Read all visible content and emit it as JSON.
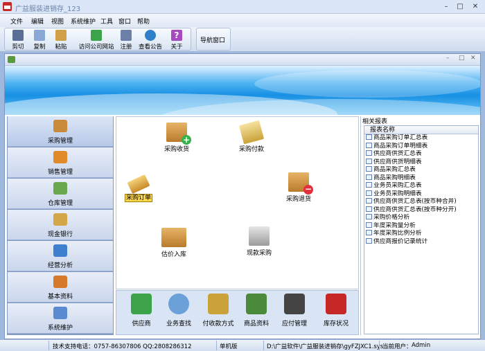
{
  "window": {
    "title": "广益服装进销存_123"
  },
  "menu": [
    "文件",
    "编辑",
    "视图",
    "系统维护",
    "工具",
    "窗口",
    "帮助"
  ],
  "toolbar": {
    "buttons": [
      {
        "label": "剪切",
        "icon": "scissors-icon"
      },
      {
        "label": "复制",
        "icon": "copy-icon"
      },
      {
        "label": "粘贴",
        "icon": "paste-icon"
      },
      {
        "label": "访问公司网站",
        "icon": "website-icon"
      },
      {
        "label": "注册",
        "icon": "register-icon"
      },
      {
        "label": "查看公告",
        "icon": "globe-icon"
      },
      {
        "label": "关于",
        "icon": "help-icon"
      }
    ],
    "nav_label": "导航窗口"
  },
  "sidebar": {
    "items": [
      {
        "label": "采购管理",
        "icon": "truck-icon",
        "color": "#c98a3a",
        "active": true
      },
      {
        "label": "销售管理",
        "icon": "coins-icon",
        "color": "#e08a2a"
      },
      {
        "label": "仓库管理",
        "icon": "blocks-icon",
        "color": "#6aa84f"
      },
      {
        "label": "现金银行",
        "icon": "bank-icon",
        "color": "#d4a64a"
      },
      {
        "label": "经营分析",
        "icon": "chart-icon",
        "color": "#3f7fd0"
      },
      {
        "label": "基本资料",
        "icon": "book-icon",
        "color": "#d67a2a"
      },
      {
        "label": "系统维护",
        "icon": "tools-icon",
        "color": "#5a8ad0"
      }
    ]
  },
  "workflow": {
    "purchase_receive": "采购收货",
    "purchase_payment": "采购付款",
    "purchase_order": "采购订单",
    "purchase_return": "采购退货",
    "estimated_stock_in": "估价入库",
    "cash_purchase": "现款采购"
  },
  "quickbar": [
    {
      "label": "供应商",
      "icon": "supplier-icon",
      "color": "#3da34a"
    },
    {
      "label": "业务查找",
      "icon": "magnifier-icon",
      "color": "#6ba0d8"
    },
    {
      "label": "付收款方式",
      "icon": "moneybag-icon",
      "color": "#c9a23a"
    },
    {
      "label": "商品资料",
      "icon": "books-icon",
      "color": "#4a8a3a"
    },
    {
      "label": "应付管理",
      "icon": "printer-icon",
      "color": "#444444"
    },
    {
      "label": "库存状况",
      "icon": "warehouse-icon",
      "color": "#c62828"
    }
  ],
  "reports": {
    "title": "相关报表",
    "column": "报表名称",
    "items": [
      "商品采购订单汇总表",
      "商品采购订单明细表",
      "供应商供货汇总表",
      "供应商供货明细表",
      "商品采购汇总表",
      "商品采购明细表",
      "业务员采购汇总表",
      "业务员采购明细表",
      "供应商供货汇总表(按币种合并)",
      "供应商供货汇总表(按币种分开)",
      "采购价格分析",
      "年度采购量分析",
      "年度采购比例分析",
      "供应商报价记录统计"
    ]
  },
  "status": {
    "support": "技术支持电话：0757-86307806 QQ:2808286312",
    "edition": "单机版",
    "path": "D:\\广益软件\\广益服装进销存\\gyFZJXC1.sys",
    "user_label": "当前用户：",
    "user": "Admin"
  }
}
